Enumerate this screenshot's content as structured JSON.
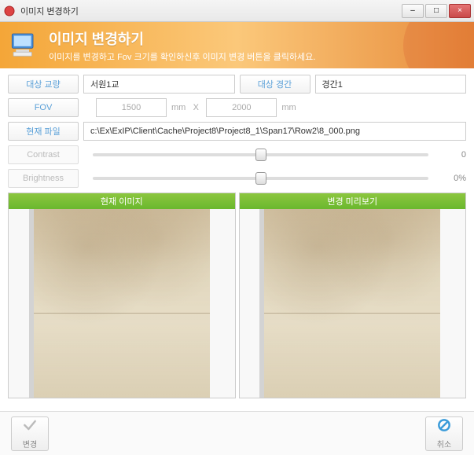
{
  "window": {
    "title": "이미지 변경하기",
    "minimize": "–",
    "maximize": "□",
    "close": "×"
  },
  "header": {
    "title": "이미지 변경하기",
    "subtitle": "이미지를 변경하고 Fov 크기를 확인하신후 이미지 변경 버튼을 클릭하세요."
  },
  "labels": {
    "target_bridge": "대상 교량",
    "target_span": "대상 경간",
    "fov": "FOV",
    "current_file": "현재 파일",
    "contrast": "Contrast",
    "brightness": "Brightness",
    "unit_mm1": "mm",
    "unit_mm2": "mm",
    "x": "X"
  },
  "values": {
    "bridge": "서원1교",
    "span": "경간1",
    "fov_w": "1500",
    "fov_h": "2000",
    "file_path": "c:\\Ex\\ExIP\\Client\\Cache\\Project8\\Project8_1\\Span17\\Row2\\8_000.png",
    "contrast": "0",
    "brightness": "0%"
  },
  "preview": {
    "left_title": "현재 이미지",
    "right_title": "변경 미리보기"
  },
  "footer": {
    "apply": "변경",
    "cancel": "취소"
  }
}
